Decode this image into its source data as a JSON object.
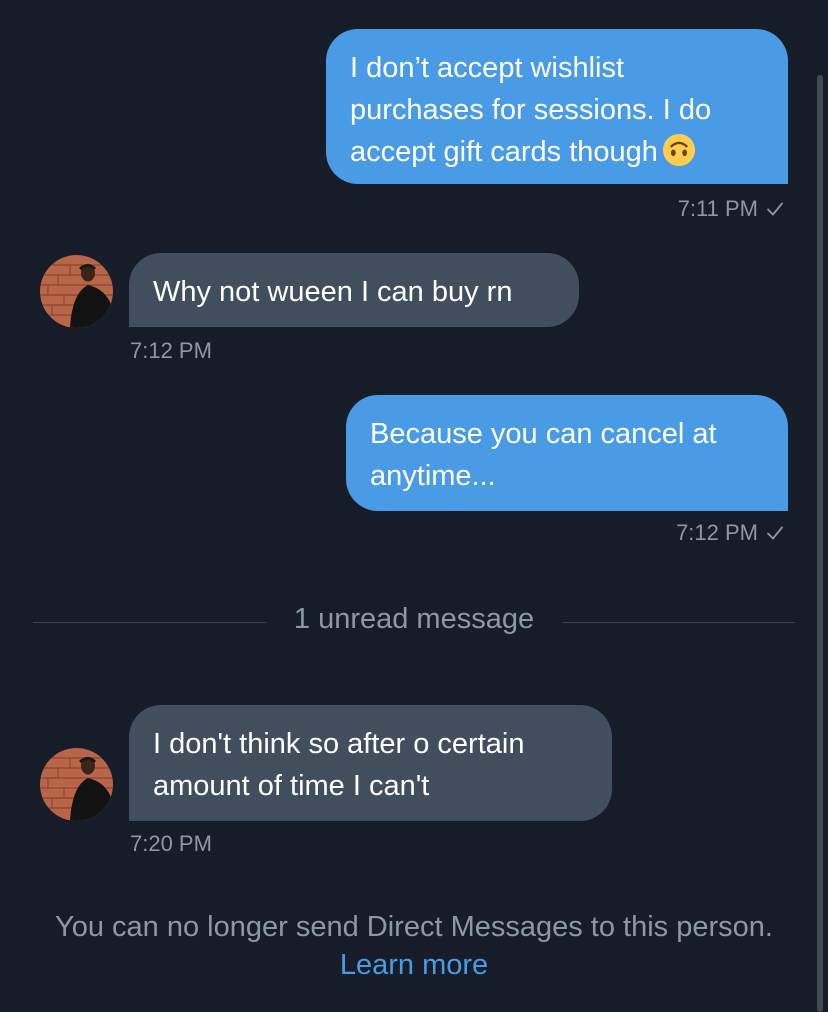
{
  "conversation": {
    "messages": [
      {
        "direction": "outgoing",
        "lines": [
          "I don’t accept wishlist",
          "purchases for sessions. I do",
          "accept gift cards though"
        ],
        "emoji": "upside-down-face-emoji",
        "time": "7:11 PM",
        "status": "sent-check-icon"
      },
      {
        "direction": "incoming",
        "lines": [
          "Why not wueen I can buy rn"
        ],
        "time": "7:12 PM"
      },
      {
        "direction": "outgoing",
        "lines": [
          "Because you can cancel at",
          "anytime..."
        ],
        "time": "7:12 PM",
        "status": "sent-check-icon"
      },
      {
        "direction": "incoming",
        "lines": [
          "I don't think so after o certain",
          "amount of time I can't"
        ],
        "time": "7:20 PM"
      }
    ],
    "unread_divider": "1 unread message",
    "notice": {
      "text": "You can no longer send Direct Messages to this person.",
      "link": "Learn more"
    }
  },
  "colors": {
    "background": "#161d28",
    "outgoing_bubble": "#4a9be6",
    "incoming_bubble": "#414e5e",
    "muted_text": "#8b98a5",
    "link": "#4a9be6"
  }
}
